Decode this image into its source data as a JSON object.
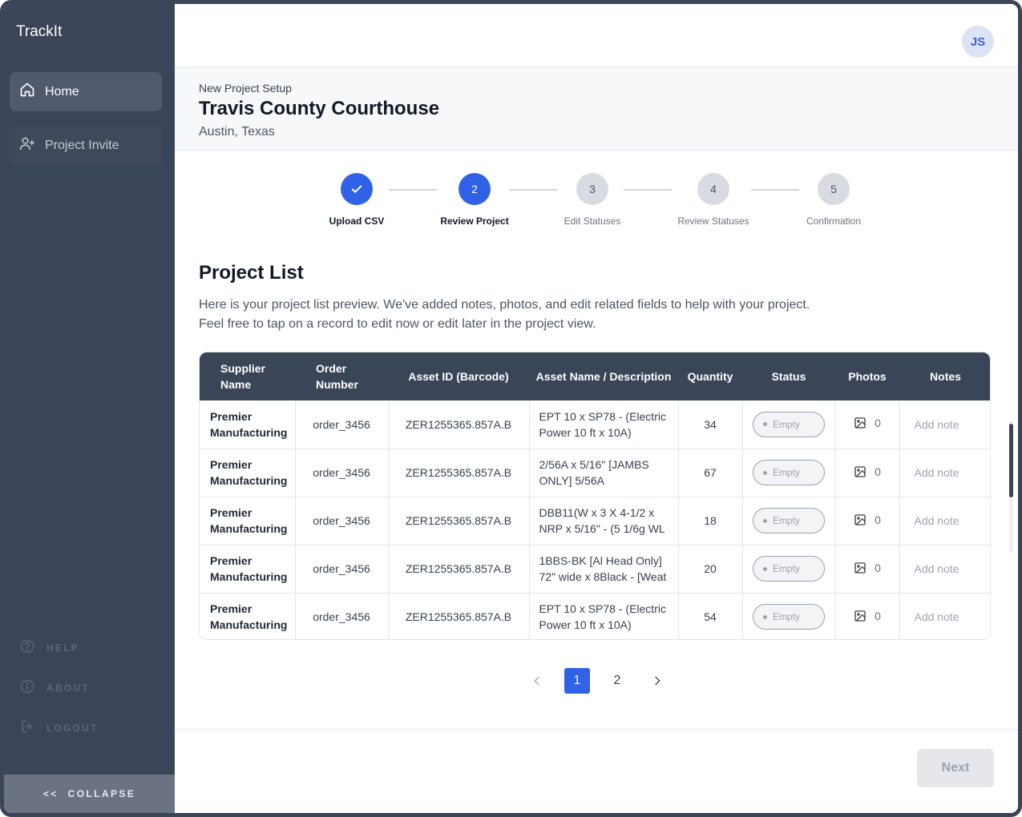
{
  "app": {
    "name": "TrackIt"
  },
  "user": {
    "initials": "JS"
  },
  "sidebar": {
    "items": [
      {
        "label": "Home",
        "icon": "home-icon",
        "active": true
      },
      {
        "label": "Project Invite",
        "icon": "user-plus-icon",
        "active": false
      }
    ],
    "bottom": [
      {
        "label": "HELP",
        "icon": "help-icon"
      },
      {
        "label": "ABOUT",
        "icon": "info-icon"
      },
      {
        "label": "LOGOUT",
        "icon": "logout-icon"
      }
    ],
    "collapse_label": "COLLAPSE",
    "collapse_arrows": "<<"
  },
  "header": {
    "kicker": "New Project Setup",
    "title": "Travis County Courthouse",
    "location": "Austin, Texas"
  },
  "stepper": {
    "steps": [
      {
        "number": "1",
        "label": "Upload CSV",
        "state": "done"
      },
      {
        "number": "2",
        "label": "Review Project",
        "state": "current"
      },
      {
        "number": "3",
        "label": "Edit Statuses",
        "state": "todo"
      },
      {
        "number": "4",
        "label": "Review Statuses",
        "state": "todo"
      },
      {
        "number": "5",
        "label": "Confirmation",
        "state": "todo"
      }
    ]
  },
  "project_list": {
    "title": "Project List",
    "description_line1": "Here is your project list preview. We've added notes, photos, and edit related fields to help with your project.",
    "description_line2": "Feel free to tap on a record to edit now or edit later in the project view.",
    "columns": {
      "supplier_line1": "Supplier",
      "supplier_line2": "Name",
      "order_line1": "Order",
      "order_line2": "Number",
      "asset_id": "Asset ID (Barcode)",
      "asset_name": "Asset Name / Description",
      "quantity": "Quantity",
      "status": "Status",
      "photos": "Photos",
      "notes": "Notes"
    },
    "rows": [
      {
        "supplier_line1": "Premier",
        "supplier_line2": "Manufacturing",
        "order": "order_3456",
        "asset_id": "ZER1255365.857A.B",
        "name_line1": "EPT 10 x SP78 - (Electric",
        "name_line2": "Power 10 ft x 10A)",
        "quantity": "34",
        "status": "Empty",
        "photos": "0",
        "note": "Add note"
      },
      {
        "supplier_line1": "Premier",
        "supplier_line2": "Manufacturing",
        "order": "order_3456",
        "asset_id": "ZER1255365.857A.B",
        "name_line1": "2/56A x 5/16\" [JAMBS",
        "name_line2": "ONLY] 5/56A",
        "quantity": "67",
        "status": "Empty",
        "photos": "0",
        "note": "Add note"
      },
      {
        "supplier_line1": "Premier",
        "supplier_line2": "Manufacturing",
        "order": "order_3456",
        "asset_id": "ZER1255365.857A.B",
        "name_line1": "DBB11(W x 3 X 4-1/2 x",
        "name_line2": "NRP x 5/16\" - (5 1/6g WL",
        "quantity": "18",
        "status": "Empty",
        "photos": "0",
        "note": "Add note"
      },
      {
        "supplier_line1": "Premier",
        "supplier_line2": "Manufacturing",
        "order": "order_3456",
        "asset_id": "ZER1255365.857A.B",
        "name_line1": "1BBS-BK [Al Head Only]",
        "name_line2": "72\" wide x 8Black - [Weat",
        "quantity": "20",
        "status": "Empty",
        "photos": "0",
        "note": "Add note"
      },
      {
        "supplier_line1": "Premier",
        "supplier_line2": "Manufacturing",
        "order": "order_3456",
        "asset_id": "ZER1255365.857A.B",
        "name_line1": "EPT 10 x SP78 - (Electric",
        "name_line2": "Power 10 ft x 10A)",
        "quantity": "54",
        "status": "Empty",
        "photos": "0",
        "note": "Add note"
      }
    ]
  },
  "pagination": {
    "pages": [
      "1",
      "2"
    ],
    "current": "1"
  },
  "footer": {
    "next_label": "Next"
  },
  "colors": {
    "accent": "#2f62e6",
    "sidebar": "#3b4558",
    "table_header": "#3b4558"
  }
}
